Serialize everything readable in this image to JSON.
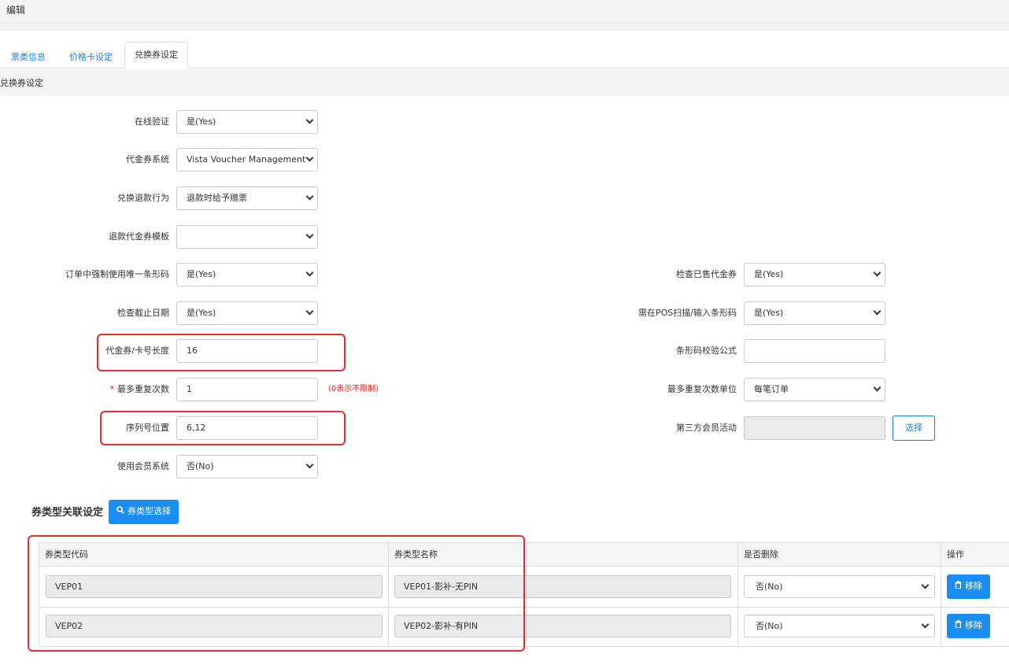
{
  "header": {
    "title": "编辑"
  },
  "tabs": [
    {
      "label": "票类信息"
    },
    {
      "label": "价格卡设定"
    },
    {
      "label": "兑换券设定"
    }
  ],
  "section": {
    "title": "兑换券设定"
  },
  "left_fields": [
    {
      "label": "在线验证",
      "type": "select",
      "value": "是(Yes)"
    },
    {
      "label": "代金券系统",
      "type": "select",
      "value": "Vista Voucher Management"
    },
    {
      "label": "兑换退款行为",
      "type": "select",
      "value": "退款时给予赠票"
    },
    {
      "label": "退款代金券模板",
      "type": "select",
      "value": ""
    },
    {
      "label": "订单中强制使用唯一条形码",
      "type": "select",
      "value": "是(Yes)"
    },
    {
      "label": "检查截止日期",
      "type": "select",
      "value": "是(Yes)"
    },
    {
      "label": "代金券/卡号长度",
      "type": "input",
      "value": "16"
    },
    {
      "label": "最多重复次数",
      "type": "input",
      "value": "1",
      "required": "*",
      "hint": "(0表示不限制)"
    },
    {
      "label": "序列号位置",
      "type": "input",
      "value": "6,12"
    },
    {
      "label": "使用会员系统",
      "type": "select",
      "value": "否(No)"
    }
  ],
  "right_fields": [
    {
      "label": "检查已售代金券",
      "type": "select",
      "value": "是(Yes)"
    },
    {
      "label": "需在POS扫描/输入条形码",
      "type": "select",
      "value": "是(Yes)"
    },
    {
      "label": "条形码校验公式",
      "type": "input",
      "value": ""
    },
    {
      "label": "最多重复次数单位",
      "type": "select",
      "value": "每笔订单"
    },
    {
      "label": "第三方会员活动",
      "type": "input-disabled",
      "value": "",
      "button": "选择"
    }
  ],
  "assoc": {
    "title": "券类型关联设定",
    "select_button": "券类型选择",
    "columns": [
      "券类型代码",
      "券类型名称",
      "是否删除",
      "操作"
    ],
    "rows": [
      {
        "code": "VEP01",
        "name": "VEP01-影补-无PIN",
        "deleted": "否(No)",
        "action": "移除"
      },
      {
        "code": "VEP02",
        "name": "VEP02-影补-有PIN",
        "deleted": "否(No)",
        "action": "移除"
      }
    ]
  },
  "colors": {
    "accent": "#1a8ef2",
    "link": "#1b7fd6",
    "highlight": "#e03030",
    "required": "#e02020"
  }
}
